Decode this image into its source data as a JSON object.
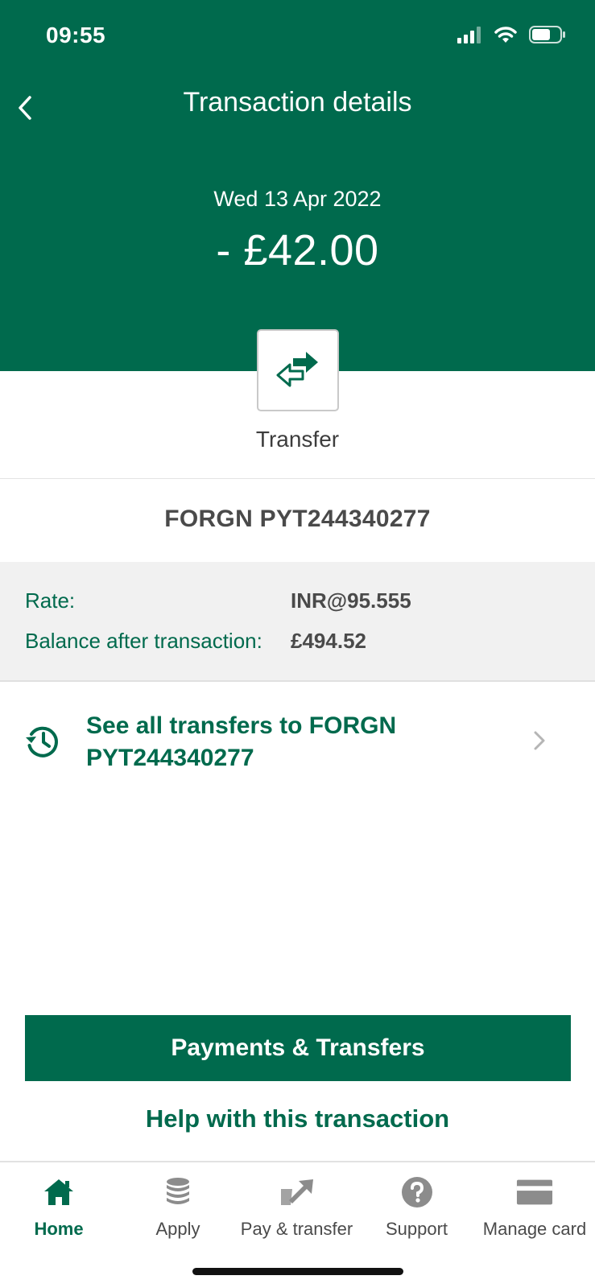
{
  "status_bar": {
    "time": "09:55",
    "icons": [
      "signal-icon",
      "wifi-icon",
      "battery-icon"
    ]
  },
  "header": {
    "back_icon": "chevron-left-icon",
    "title": "Transaction details",
    "date": "Wed 13 Apr 2022",
    "amount": "- £42.00"
  },
  "transaction_type": {
    "icon": "transfer-arrows-icon",
    "label": "Transfer"
  },
  "payee": "FORGN PYT244340277",
  "details": {
    "rate_label": "Rate:",
    "rate_value": "INR@95.555",
    "balance_label": "Balance after transaction:",
    "balance_value": "£494.52"
  },
  "see_all": {
    "icon": "history-icon",
    "label": "See all transfers to FORGN PYT244340277",
    "chevron": "chevron-right-icon"
  },
  "actions": {
    "primary_label": "Payments & Transfers",
    "help_label": "Help with this transaction"
  },
  "tabbar": {
    "items": [
      {
        "label": "Home",
        "icon": "home-icon",
        "active": true
      },
      {
        "label": "Apply",
        "icon": "coins-stack-icon",
        "active": false
      },
      {
        "label": "Pay & transfer",
        "icon": "pay-transfer-icon",
        "active": false
      },
      {
        "label": "Support",
        "icon": "question-icon",
        "active": false
      },
      {
        "label": "Manage card",
        "icon": "card-icon",
        "active": false
      }
    ]
  },
  "colors": {
    "brand_green": "#006a4d",
    "panel_gray": "#f1f1f1",
    "inactive_icon": "#8c8c8c"
  }
}
